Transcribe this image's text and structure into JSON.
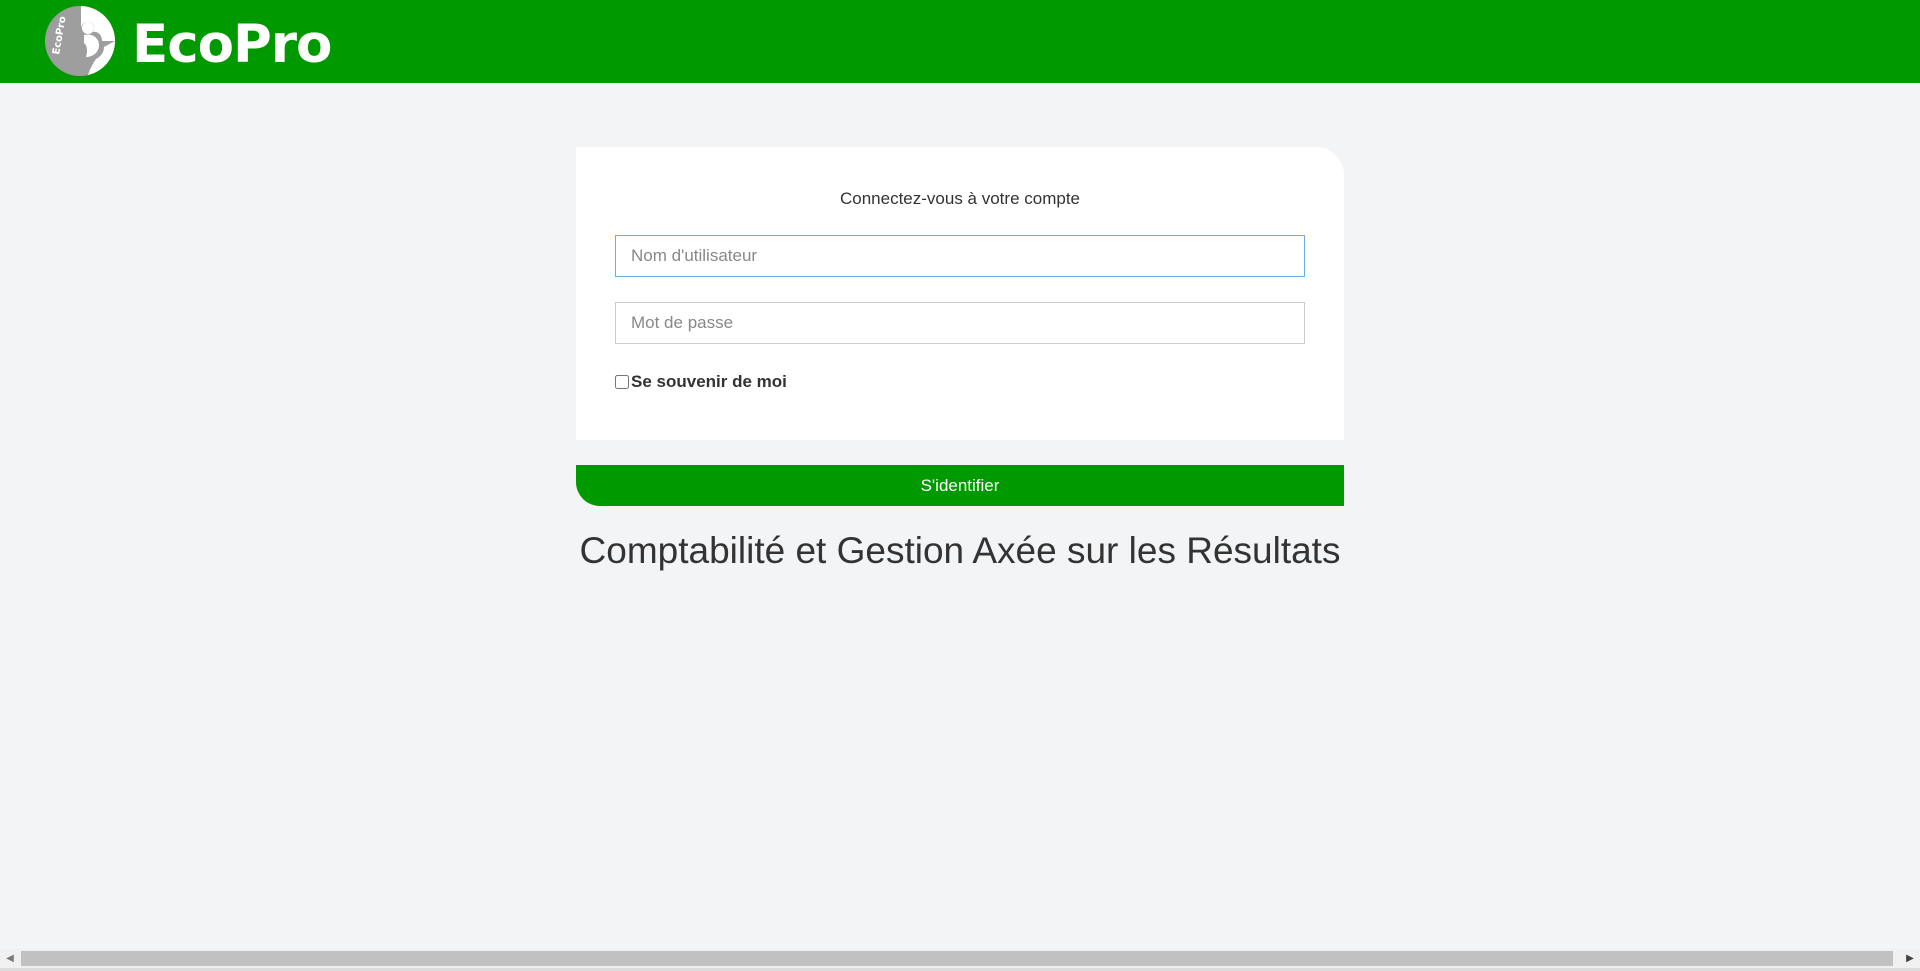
{
  "brand": {
    "name": "EcoPro",
    "logo_lettering": "EcoPro",
    "header_color": "#009a00"
  },
  "login": {
    "heading": "Connectez-vous à votre compte",
    "username_placeholder": "Nom d'utilisateur",
    "username_value": "",
    "password_placeholder": "Mot de passe",
    "password_value": "",
    "remember_label": "Se souvenir de moi",
    "remember_checked": false,
    "submit_label": "S'identifier"
  },
  "tagline": "Comptabilité et Gestion Axée sur les Résultats",
  "scrollbar": {
    "left_arrow_icon": "arrow-left-icon",
    "right_arrow_icon": "arrow-right-icon"
  }
}
